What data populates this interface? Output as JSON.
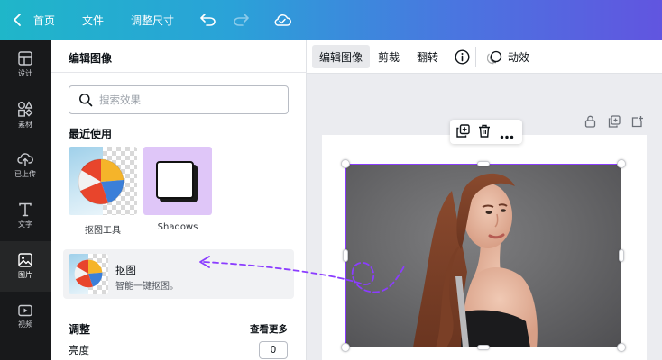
{
  "topbar": {
    "home_label": "首页",
    "file_label": "文件",
    "resize_label": "调整尺寸"
  },
  "rail": {
    "items": [
      {
        "label": "设计",
        "icon": "layout-icon"
      },
      {
        "label": "素材",
        "icon": "shapes-icon"
      },
      {
        "label": "已上传",
        "icon": "cloud-upload-icon"
      },
      {
        "label": "文字",
        "icon": "text-icon"
      },
      {
        "label": "图片",
        "icon": "image-icon"
      },
      {
        "label": "视频",
        "icon": "video-icon"
      }
    ],
    "active_index": 4
  },
  "panel": {
    "title": "编辑图像",
    "search_placeholder": "搜索效果",
    "recent_title": "最近使用",
    "recent": [
      {
        "label": "抠图工具"
      },
      {
        "label": "Shadows"
      }
    ],
    "card": {
      "title": "抠图",
      "subtitle": "智能一键抠图。"
    },
    "adjust_title": "调整",
    "see_more": "查看更多",
    "brightness_label": "亮度",
    "brightness_value": "0"
  },
  "toolbar": {
    "edit_image": "编辑图像",
    "crop": "剪裁",
    "flip": "翻转",
    "animate": "动效"
  },
  "colors": {
    "accent": "#8b3dff",
    "topbar_start": "#1fb6c9",
    "topbar_end": "#6155e0",
    "rail_bg": "#18191b"
  }
}
